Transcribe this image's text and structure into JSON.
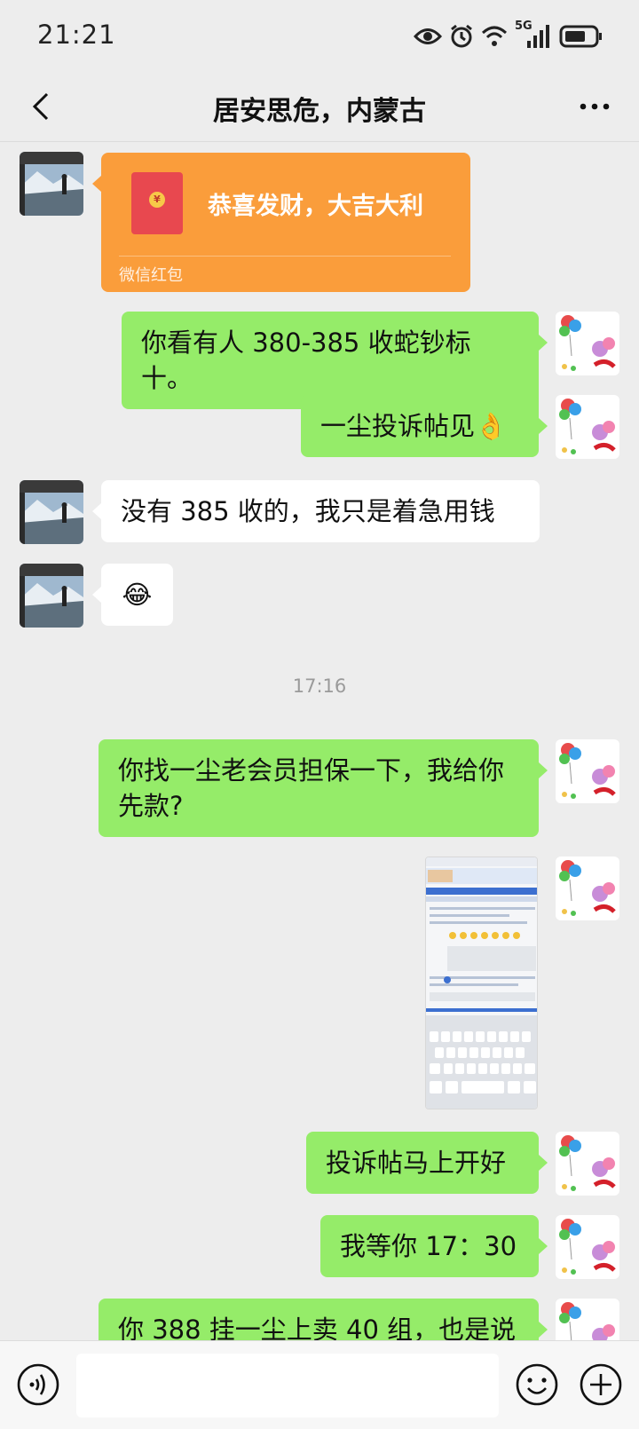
{
  "status_bar": {
    "time": "21:21",
    "network": "5G"
  },
  "nav": {
    "title": "居安思危，内蒙古"
  },
  "messages": [
    {
      "sender": "other",
      "type": "red_packet",
      "greeting": "恭喜发财，大吉大利",
      "footer": "微信红包"
    },
    {
      "sender": "self",
      "type": "text",
      "text": "你看有人 380-385 收蛇钞标十。"
    },
    {
      "sender": "self",
      "type": "text",
      "text": "一尘投诉帖见👌"
    },
    {
      "sender": "other",
      "type": "text",
      "text": "没有 385 收的，我只是着急用钱"
    },
    {
      "sender": "other",
      "type": "emoji",
      "text": "😂"
    },
    {
      "type": "timestamp",
      "text": "17:16"
    },
    {
      "sender": "self",
      "type": "text",
      "text": "你找一尘老会员担保一下，我给你先款?"
    },
    {
      "sender": "self",
      "type": "image"
    },
    {
      "sender": "self",
      "type": "text",
      "text": "投诉帖马上开好"
    },
    {
      "sender": "self",
      "type": "text",
      "text": "我等你 17：30"
    },
    {
      "sender": "self",
      "type": "text",
      "text": "你 388 挂一尘上卖 40 组，也是说"
    }
  ],
  "colors": {
    "self_bubble": "#95ec69",
    "other_bubble": "#ffffff",
    "red_packet": "#fa9d3b",
    "background": "#ededed"
  },
  "icons": {
    "back": "chevron-left-icon",
    "more": "more-dots-icon",
    "voice": "voice-icon",
    "emoji": "emoji-icon",
    "plus": "plus-icon"
  },
  "input": {
    "value": ""
  }
}
